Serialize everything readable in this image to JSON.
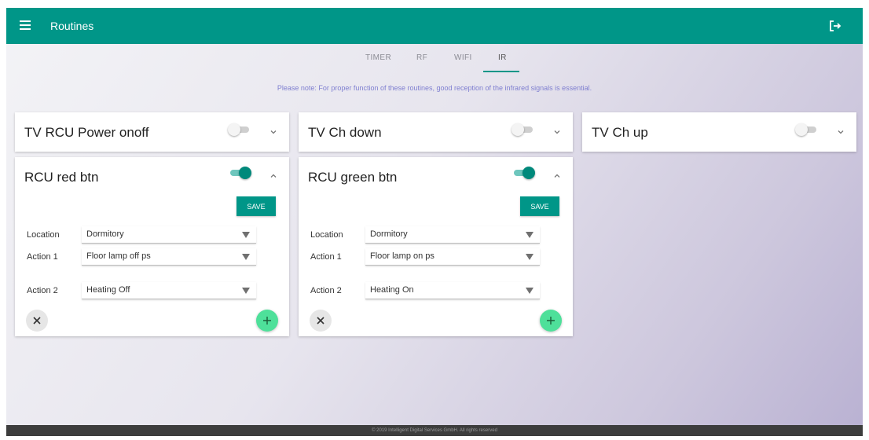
{
  "header": {
    "title": "Routines",
    "menu_icon": "hamburger-menu-icon",
    "logout_icon": "logout-icon"
  },
  "tabs": [
    {
      "label": "TIMER",
      "active": false
    },
    {
      "label": "RF",
      "active": false
    },
    {
      "label": "WIFI",
      "active": false
    },
    {
      "label": "IR",
      "active": true
    }
  ],
  "note": "Please note: For proper function of these routines, good reception of the infrared signals is essential.",
  "routines": [
    {
      "title": "TV RCU Power onoff",
      "enabled": false,
      "expanded": false
    },
    {
      "title": "TV Ch down",
      "enabled": false,
      "expanded": false
    },
    {
      "title": "TV Ch up",
      "enabled": false,
      "expanded": false
    },
    {
      "title": "RCU red btn",
      "enabled": true,
      "expanded": true,
      "save_label": "SAVE",
      "location_label": "Location",
      "location_value": "Dormitory",
      "action1_label": "Action 1",
      "action1_value": "Floor lamp off ps",
      "action2_label": "Action 2",
      "action2_value": "Heating Off"
    },
    {
      "title": "RCU green btn",
      "enabled": true,
      "expanded": true,
      "save_label": "SAVE",
      "location_label": "Location",
      "location_value": "Dormitory",
      "action1_label": "Action 1",
      "action1_value": "Floor lamp on ps",
      "action2_label": "Action 2",
      "action2_value": "Heating On"
    }
  ],
  "footer": "© 2019 Intelligent Digital Services GmbH. All rights reserved",
  "colors": {
    "primary": "#009688",
    "add_button": "#4ee09a",
    "note_text": "#7f7fd0"
  }
}
